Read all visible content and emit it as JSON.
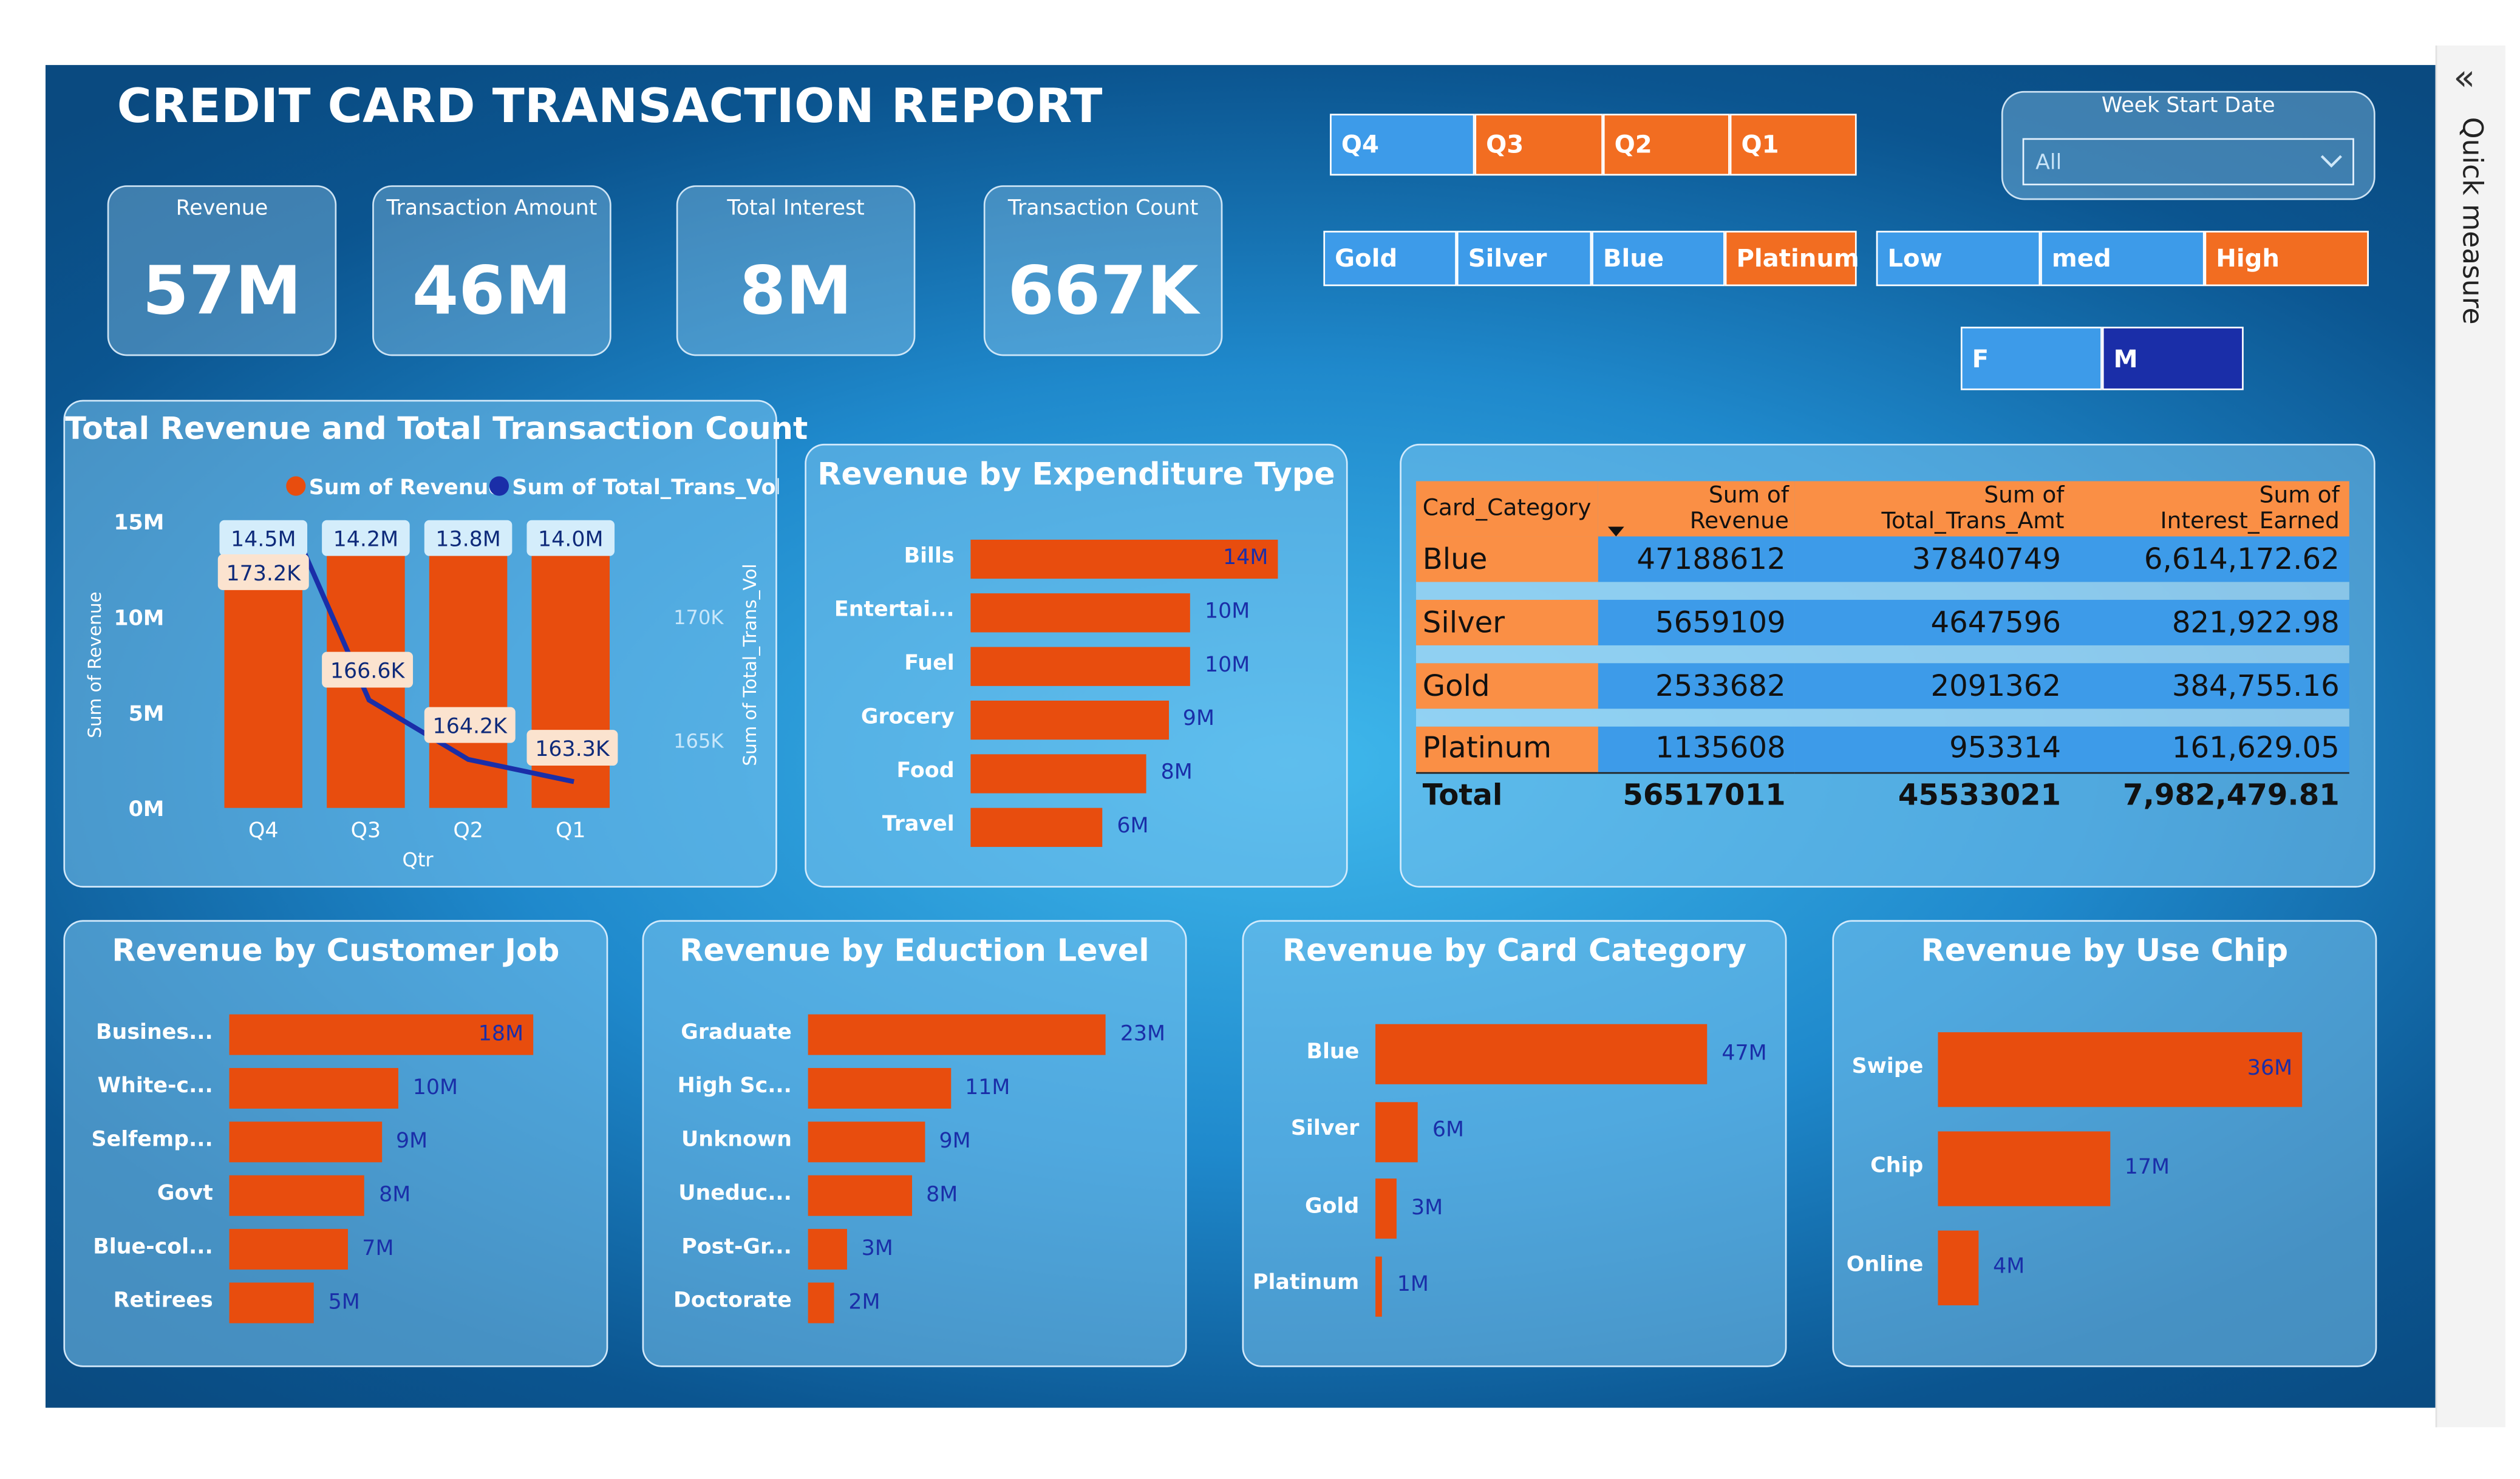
{
  "report_title": "CREDIT CARD TRANSACTION REPORT",
  "kpis": [
    {
      "label": "Revenue",
      "value": "57M"
    },
    {
      "label": "Transaction Amount",
      "value": "46M"
    },
    {
      "label": "Total Interest",
      "value": "8M"
    },
    {
      "label": "Transaction Count",
      "value": "667K"
    }
  ],
  "slicers": {
    "quarter": [
      "Q4",
      "Q3",
      "Q2",
      "Q1"
    ],
    "card": [
      "Gold",
      "Silver",
      "Blue",
      "Platinum"
    ],
    "level": [
      "Low",
      "med",
      "High"
    ],
    "gender": [
      "F",
      "M"
    ]
  },
  "week_filter": {
    "label": "Week Start Date",
    "value": "All"
  },
  "side_pane": {
    "label": "Quick measure"
  },
  "colors": {
    "bar": "#e84d0e",
    "line": "#1a2ea8",
    "slicer_blue": "#3d9be9",
    "slicer_orange": "#f26d21",
    "slicer_navy": "#1a2ea8",
    "header_orange": "#fa8f45",
    "row_blue": "#3d9be9"
  },
  "chart_data": [
    {
      "type": "bar",
      "title": "Total Revenue and Total Transaction Count",
      "legend": [
        "Sum of Revenue",
        "Sum of Total_Trans_Vol"
      ],
      "xlabel": "Qtr",
      "ylabel": "Sum of Revenue",
      "y2label": "Sum of Total_Trans_Vol",
      "categories": [
        "Q4",
        "Q3",
        "Q2",
        "Q1"
      ],
      "y_ticks": [
        "15M",
        "10M",
        "5M",
        "0M"
      ],
      "y2_ticks": [
        "170K",
        "165K"
      ],
      "ylim": [
        0,
        16
      ],
      "y2lim": [
        160,
        175
      ],
      "series": [
        {
          "name": "Sum of Revenue",
          "values": [
            14.5,
            14.2,
            13.8,
            14.0
          ],
          "labels": [
            "14.5M",
            "14.2M",
            "13.8M",
            "14.0M"
          ]
        },
        {
          "name": "Sum of Total_Trans_Vol",
          "values": [
            173.2,
            166.6,
            164.2,
            163.3
          ],
          "labels": [
            "173.2K",
            "166.6K",
            "164.2K",
            "163.3K"
          ]
        }
      ]
    },
    {
      "type": "bar",
      "title": "Revenue by Expenditure Type",
      "categories": [
        "Bills",
        "Entertai...",
        "Fuel",
        "Grocery",
        "Food",
        "Travel"
      ],
      "values": [
        14,
        10,
        10,
        9,
        8,
        6
      ],
      "labels": [
        "14M",
        "10M",
        "10M",
        "9M",
        "8M",
        "6M"
      ],
      "xlim": [
        0,
        14
      ]
    },
    {
      "type": "table",
      "columns": [
        "Card_Category",
        "Sum of Revenue",
        "Sum of Total_Trans_Amt",
        "Sum of Interest_Earned"
      ],
      "rows": [
        [
          "Blue",
          "47188612",
          "37840749",
          "6,614,172.62"
        ],
        [
          "Silver",
          "5659109",
          "4647596",
          "821,922.98"
        ],
        [
          "Gold",
          "2533682",
          "2091362",
          "384,755.16"
        ],
        [
          "Platinum",
          "1135608",
          "953314",
          "161,629.05"
        ]
      ],
      "total": [
        "Total",
        "56517011",
        "45533021",
        "7,982,479.81"
      ]
    },
    {
      "type": "bar",
      "title": "Revenue by Customer Job",
      "categories": [
        "Busines...",
        "White-c...",
        "Selfemp...",
        "Govt",
        "Blue-col...",
        "Retirees"
      ],
      "values": [
        18,
        10,
        9,
        8,
        7,
        5
      ],
      "labels": [
        "18M",
        "10M",
        "9M",
        "8M",
        "7M",
        "5M"
      ],
      "xlim": [
        0,
        18
      ]
    },
    {
      "type": "bar",
      "title": "Revenue by Eduction Level",
      "categories": [
        "Graduate",
        "High Sc...",
        "Unknown",
        "Uneduc...",
        "Post-Gr...",
        "Doctorate"
      ],
      "values": [
        23,
        11,
        9,
        8,
        3,
        2
      ],
      "labels": [
        "23M",
        "11M",
        "9M",
        "8M",
        "3M",
        "2M"
      ],
      "xlim": [
        0,
        23
      ]
    },
    {
      "type": "bar",
      "title": "Revenue by Card Category",
      "categories": [
        "Blue",
        "Silver",
        "Gold",
        "Platinum"
      ],
      "values": [
        47,
        6,
        3,
        1
      ],
      "labels": [
        "47M",
        "6M",
        "3M",
        "1M"
      ],
      "xlim": [
        0,
        47
      ]
    },
    {
      "type": "bar",
      "title": "Revenue by Use Chip",
      "categories": [
        "Swipe",
        "Chip",
        "Online"
      ],
      "values": [
        36,
        17,
        4
      ],
      "labels": [
        "36M",
        "17M",
        "4M"
      ],
      "xlim": [
        0,
        36
      ]
    }
  ]
}
